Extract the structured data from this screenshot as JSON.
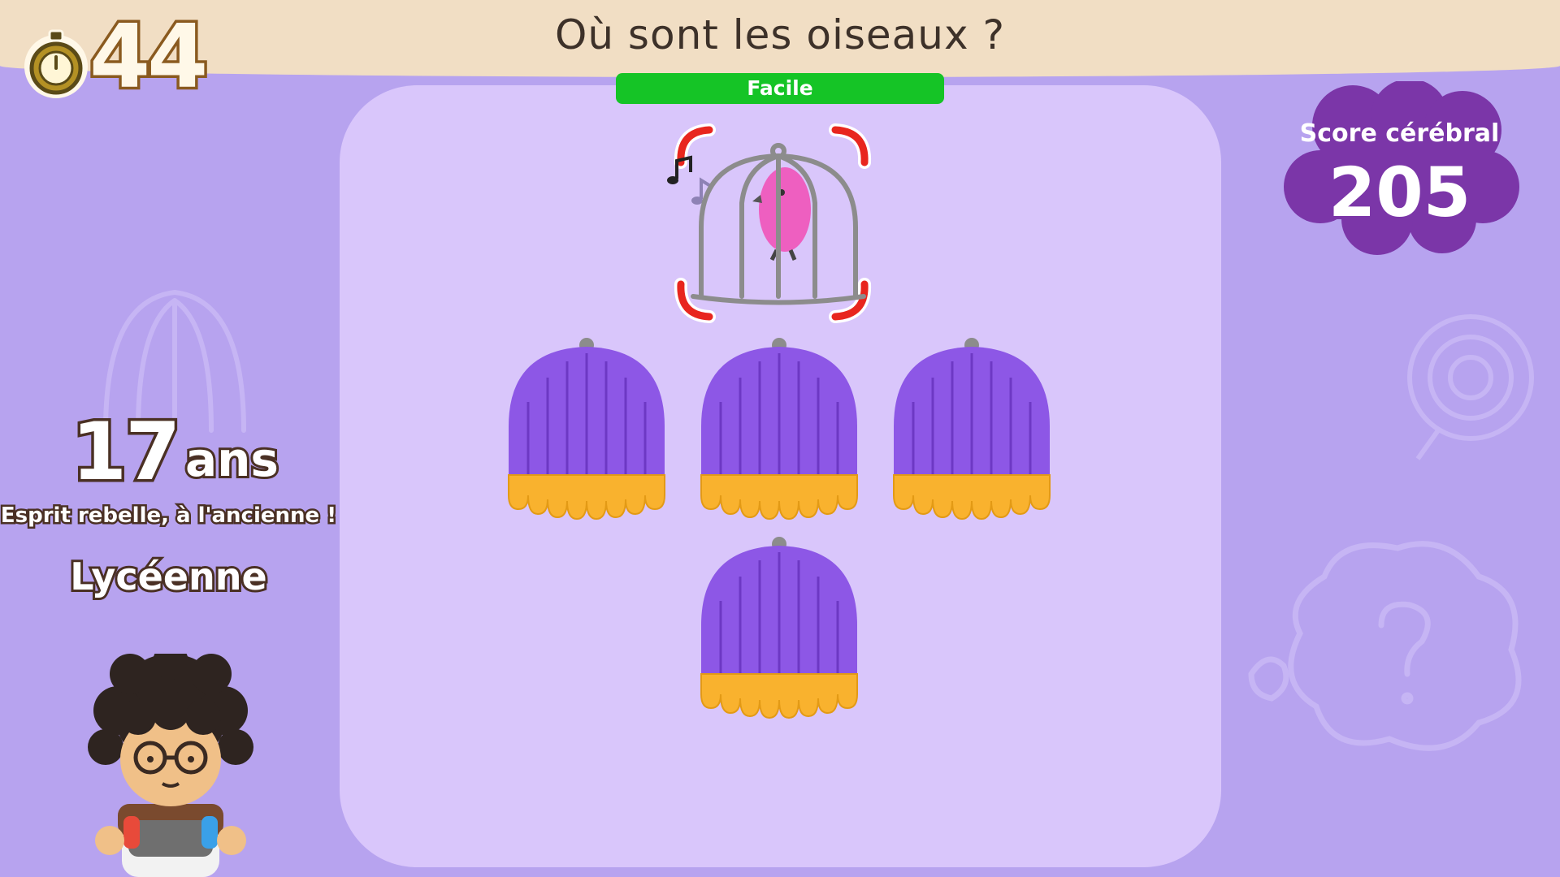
{
  "header": {
    "question": "Où sont les oiseaux ?",
    "timer_value": "44"
  },
  "difficulty": {
    "label": "Facile"
  },
  "score": {
    "label": "Score cérébral",
    "value": "205"
  },
  "player": {
    "age_number": "17",
    "age_unit": "ans",
    "tagline": "Esprit rebelle, à l'ancienne !",
    "rank": "Lycéenne"
  },
  "colors": {
    "background": "#b7a3ef",
    "board": "#d9c6fb",
    "difficulty_bar": "#15c426",
    "score_cloud": "#7b36a8",
    "cage_purple": "#8d57e6",
    "cage_orange": "#f9b22e",
    "target_bracket": "#e8261e"
  },
  "icons": [
    "stopwatch-icon",
    "music-note-icon",
    "bird-cage-icon",
    "covered-cage-icon",
    "player-avatar"
  ]
}
